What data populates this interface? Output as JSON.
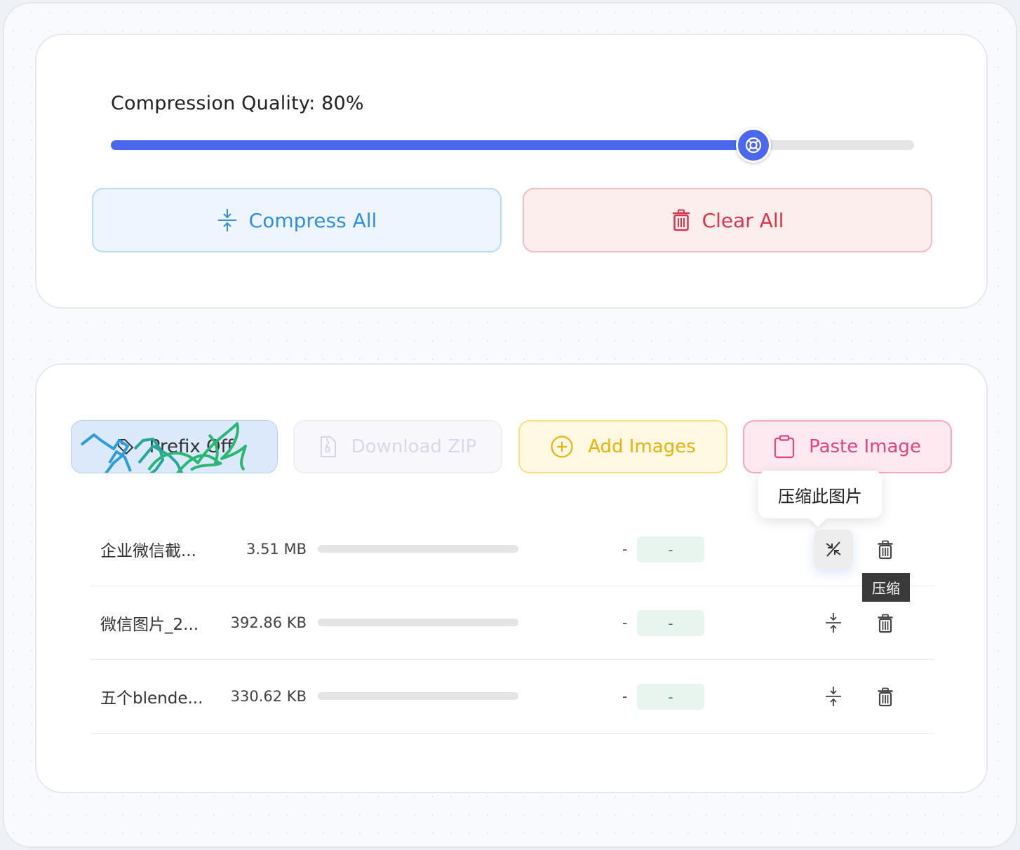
{
  "settings": {
    "quality_label": "Compression Quality: 80%",
    "quality_value": 80,
    "compress_all_label": "Compress All",
    "clear_all_label": "Clear All"
  },
  "toolbar": {
    "prefix_label": "Prefix Off",
    "download_zip_label": "Download ZIP",
    "add_images_label": "Add Images",
    "paste_image_label": "Paste Image",
    "paste_tooltip": "压缩此图片"
  },
  "files": [
    {
      "name": "企业微信截...",
      "size": "3.51 MB",
      "progress": 0,
      "compressed_size": "-",
      "ratio": "-",
      "hovered": true
    },
    {
      "name": "微信图片_2...",
      "size": "392.86 KB",
      "progress": 0,
      "compressed_size": "-",
      "ratio": "-",
      "hovered": false
    },
    {
      "name": "五个blende...",
      "size": "330.62 KB",
      "progress": 0,
      "compressed_size": "-",
      "ratio": "-",
      "hovered": false
    }
  ],
  "row_tooltip": "压缩",
  "colors": {
    "accent": "#4a68ee",
    "compress_all": "#2f8fe8",
    "clear_all": "#d9364b",
    "add_images": "#eab308",
    "paste_image": "#e3447e",
    "ratio_text": "#2e8b57"
  },
  "icons": {
    "compress_all": "compress-arrows-icon",
    "clear_all": "trash-icon",
    "prefix": "tag-icon",
    "download_zip": "zip-file-icon",
    "add_images": "plus-circle-icon",
    "paste_image": "clipboard-icon",
    "row_compress": "compress-arrows-icon",
    "row_delete": "trash-icon"
  }
}
